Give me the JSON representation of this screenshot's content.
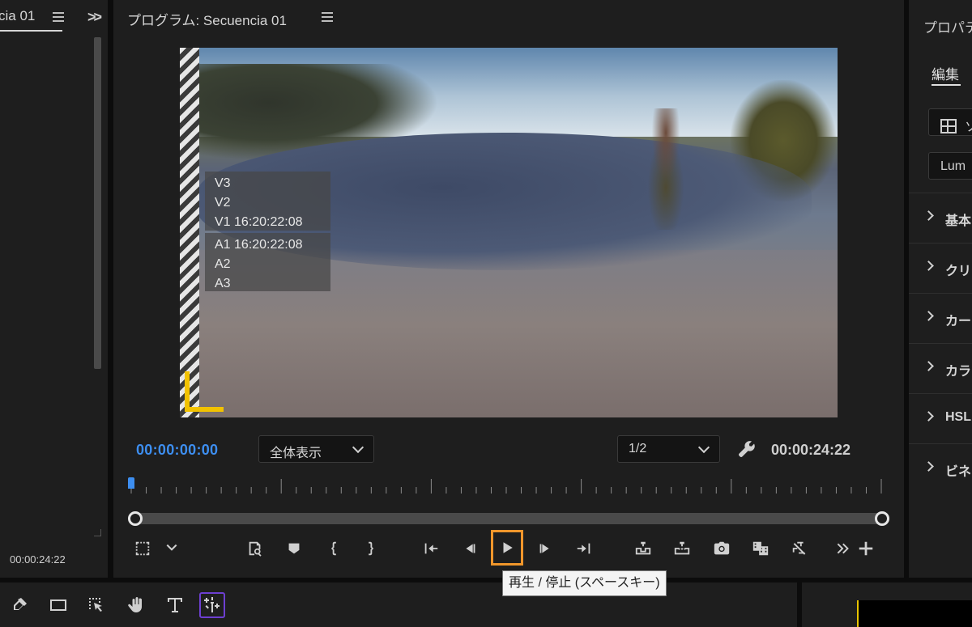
{
  "left_panel": {
    "tab_title": "cia 01",
    "timecode": "00:00:24:22"
  },
  "program": {
    "title": "プログラム: Secuencia 01",
    "overlay": {
      "video_tracks": [
        "V3",
        "V2",
        "V1 16:20:22:08"
      ],
      "audio_tracks": [
        "A1 16:20:22:08",
        "A2",
        "A3"
      ]
    },
    "current_timecode": "00:00:00:00",
    "zoom_dropdown": "全体表示",
    "resolution_dropdown": "1/2",
    "duration_timecode": "00:00:24:22",
    "tooltip": "再生 / 停止 (スペースキー)"
  },
  "right_panel": {
    "title": "プロパテ",
    "tab": "編集",
    "box1": "ソ",
    "box2": "Lum",
    "sections": [
      "基本",
      "クリ",
      "カー",
      "カラ",
      "HSL",
      "ビネ"
    ]
  },
  "colors": {
    "accent_blue": "#3d8ef0",
    "highlight_orange": "#f0962b",
    "safe_margin_yellow": "#f2c200",
    "tool_selected_purple": "#6d3fd1"
  }
}
